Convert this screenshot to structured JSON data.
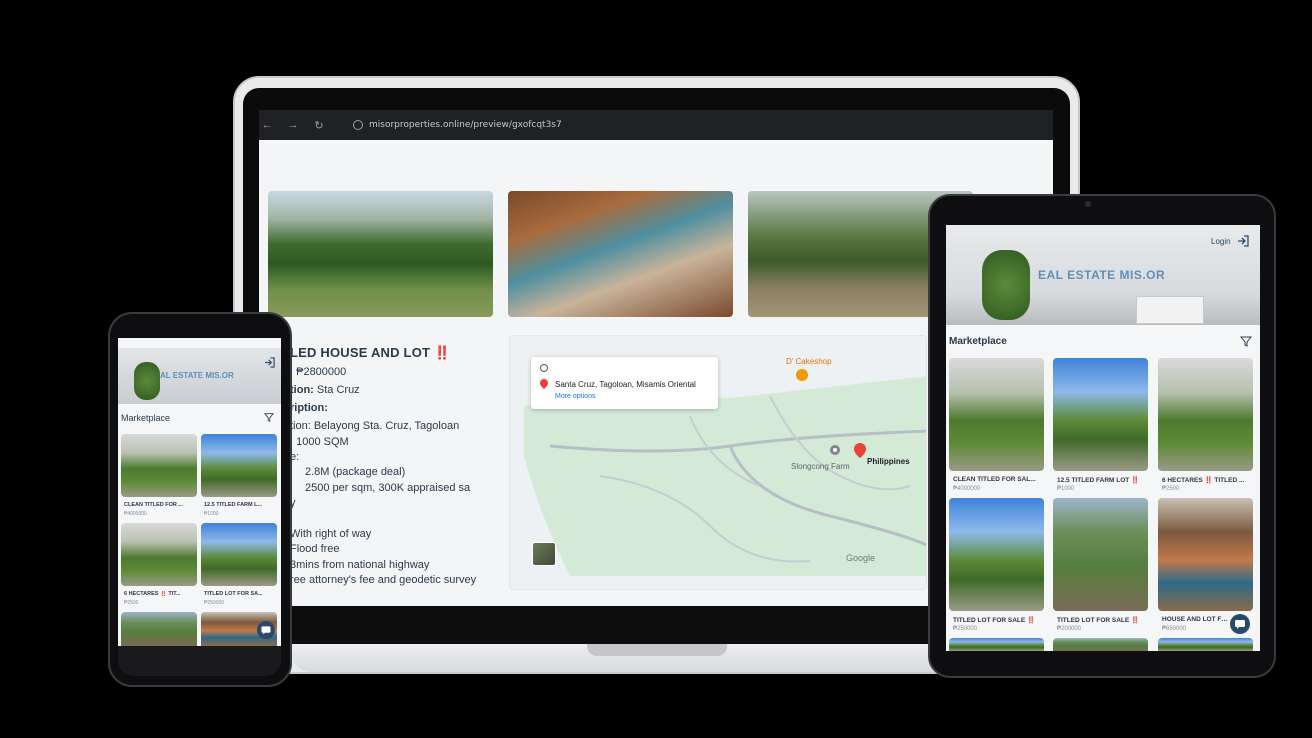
{
  "laptop": {
    "url": "misorproperties.online/preview/gxofcqt3s7",
    "listing": {
      "title": "LED HOUSE AND LOT ‼️",
      "lines": [
        ": ₱2800000",
        "tion: Sta Cruz",
        "ription:",
        "tion: Belayong Sta. Cruz, Tagoloan",
        ": 1000 SQM",
        "e:",
        "2.8M (package deal)",
        "2500 per sqm, 300K appraised sa",
        "y",
        "With right of way",
        "Flood free",
        "3mins from national highway",
        "ree attorney's fee and geodetic survey"
      ],
      "label_bold": "tion:",
      "location_value": "Sta Cruz"
    },
    "map": {
      "address": "Santa Cruz, Tagoloan, Misamis Oriental",
      "more_options": "More options",
      "poi_cakeshop": "D' Cakeshop",
      "poi_farm": "Slongcong Farm",
      "poi_country": "Philippines",
      "attribution": "Google"
    }
  },
  "tablet": {
    "brand": "EAL ESTATE MIS.OR",
    "login": "Login",
    "section": "Marketplace",
    "cards": [
      {
        "title": "CLEAN TITLED FOR SAL...",
        "price": "₱4000000",
        "badge": "‼️"
      },
      {
        "title": "12.5 TITLED FARM LOT ‼️",
        "price": "₱1000"
      },
      {
        "title": "6 HECTARES ‼️ TITLED ...",
        "price": "₱2500"
      },
      {
        "title": "TITLED LOT FOR SALE ‼️",
        "price": "₱250000"
      },
      {
        "title": "TITLED LOT FOR SALE ‼️",
        "price": "₱200000"
      },
      {
        "title": "HOUSE AND LOT FOR SALE",
        "price": "₱650000"
      }
    ]
  },
  "phone": {
    "brand": "AL ESTATE MIS.OR",
    "section": "Marketplace",
    "cards": [
      {
        "title": "CLEAN TITLED FOR ...",
        "price": "₱4000000"
      },
      {
        "title": "12.5 TITLED FARM L...",
        "price": "₱1000"
      },
      {
        "title": "6 HECTARES ‼️ TIT...",
        "price": "₱2500"
      },
      {
        "title": "TITLED LOT FOR SA...",
        "price": "₱250000"
      }
    ]
  },
  "colors": {
    "brand_blue": "#5f8fb8",
    "dark_navy": "#2a4a6a",
    "map_green": "#d4ead7",
    "pin_red": "#ea4335"
  },
  "icons": [
    "back-icon",
    "forward-icon",
    "reload-icon",
    "site-info-icon",
    "map-pin-icon",
    "login-icon",
    "filter-icon",
    "chat-icon"
  ]
}
